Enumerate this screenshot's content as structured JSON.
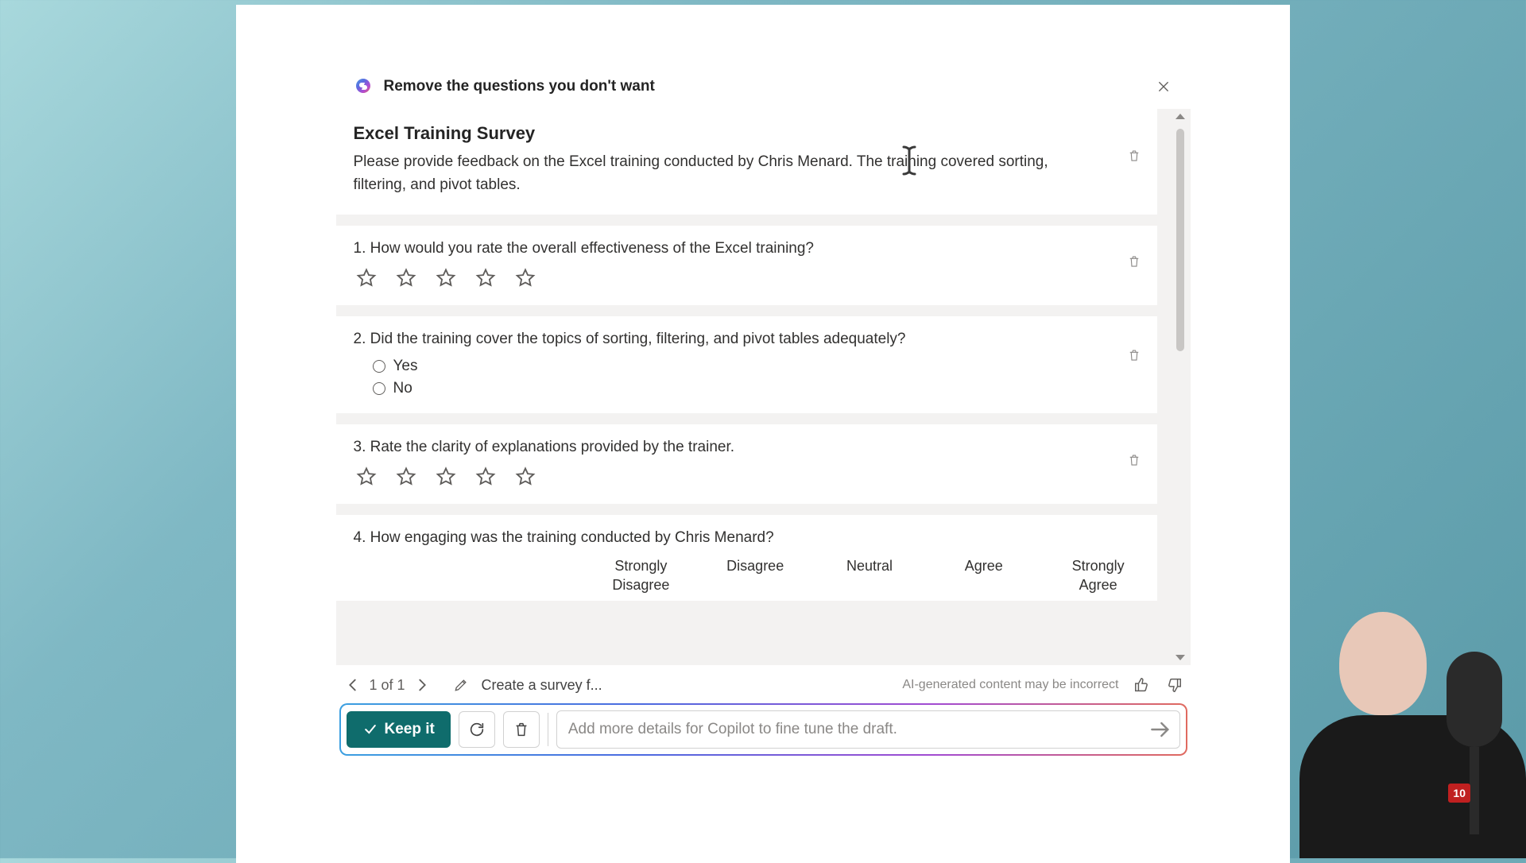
{
  "header": {
    "title": "Remove the questions you don't want"
  },
  "survey": {
    "title": "Excel Training Survey",
    "description": "Please provide feedback on the Excel training conducted by Chris Menard. The training covered sorting, filtering, and pivot tables."
  },
  "questions": [
    {
      "number": "1.",
      "text": "How would you rate the overall effectiveness of the Excel training?",
      "type": "rating"
    },
    {
      "number": "2.",
      "text": "Did the training cover the topics of sorting, filtering, and pivot tables adequately?",
      "type": "radio",
      "options": [
        "Yes",
        "No"
      ]
    },
    {
      "number": "3.",
      "text": "Rate the clarity of explanations provided by the trainer.",
      "type": "rating"
    },
    {
      "number": "4.",
      "text": "How engaging was the training conducted by Chris Menard?",
      "type": "likert",
      "scale": [
        "Strongly Disagree",
        "Disagree",
        "Neutral",
        "Agree",
        "Strongly Agree"
      ]
    }
  ],
  "footer": {
    "page_indicator": "1 of 1",
    "prompt_preview": "Create a survey f...",
    "disclaimer": "AI-generated content may be incorrect"
  },
  "actions": {
    "keep_label": "Keep it",
    "input_placeholder": "Add more details for Copilot to fine tune the draft."
  },
  "presenter_badge": "10"
}
